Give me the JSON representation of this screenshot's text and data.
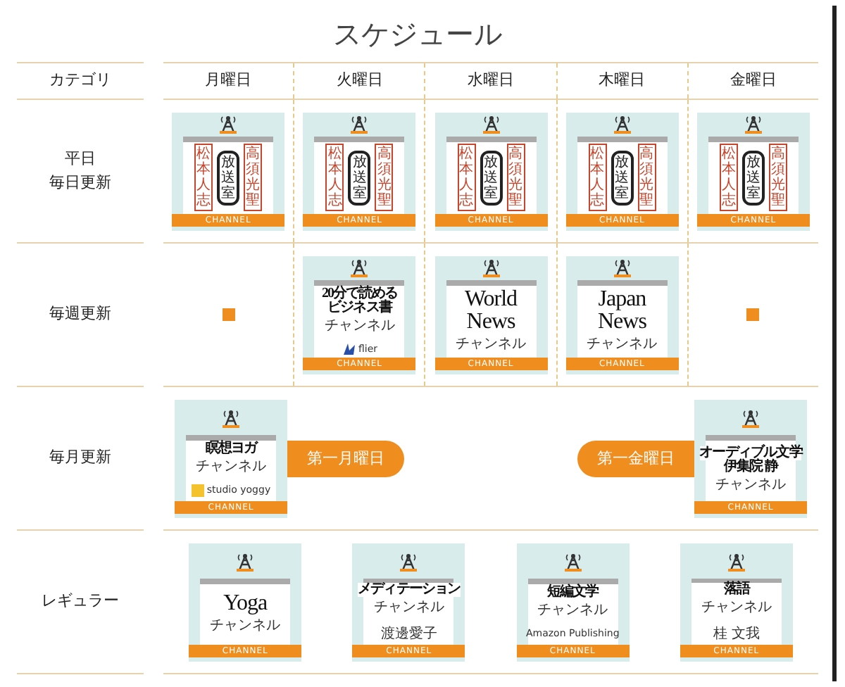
{
  "title": "スケジュール",
  "header": {
    "category": "カテゴリ",
    "days": [
      "月曜日",
      "火曜日",
      "水曜日",
      "木曜日",
      "金曜日"
    ]
  },
  "rows": [
    {
      "kind": "days",
      "category": [
        "平日",
        "毎日更新"
      ],
      "cells": [
        {
          "kind": "seal_cover",
          "seals": [
            {
              "text": "松本人志",
              "color": "#c8442a"
            },
            {
              "text": "放送室",
              "color": "#222222"
            },
            {
              "text": "高須光聖",
              "color": "#c8442a"
            }
          ],
          "band": "CHANNEL"
        },
        {
          "kind": "seal_cover",
          "seals": [
            {
              "text": "松本人志",
              "color": "#c8442a"
            },
            {
              "text": "放送室",
              "color": "#222222"
            },
            {
              "text": "高須光聖",
              "color": "#c8442a"
            }
          ],
          "band": "CHANNEL"
        },
        {
          "kind": "seal_cover",
          "seals": [
            {
              "text": "松本人志",
              "color": "#c8442a"
            },
            {
              "text": "放送室",
              "color": "#222222"
            },
            {
              "text": "高須光聖",
              "color": "#c8442a"
            }
          ],
          "band": "CHANNEL"
        },
        {
          "kind": "seal_cover",
          "seals": [
            {
              "text": "松本人志",
              "color": "#c8442a"
            },
            {
              "text": "放送室",
              "color": "#222222"
            },
            {
              "text": "高須光聖",
              "color": "#c8442a"
            }
          ],
          "band": "CHANNEL"
        },
        {
          "kind": "seal_cover",
          "seals": [
            {
              "text": "松本人志",
              "color": "#c8442a"
            },
            {
              "text": "放送室",
              "color": "#222222"
            },
            {
              "text": "高須光聖",
              "color": "#c8442a"
            }
          ],
          "band": "CHANNEL"
        }
      ]
    },
    {
      "kind": "days",
      "category": [
        "毎週更新"
      ],
      "cells": [
        {
          "kind": "none"
        },
        {
          "kind": "title_cover",
          "title": [
            "20分で読める",
            "ビジネス書"
          ],
          "subtitle": "チャンネル",
          "credit": {
            "text": "flier",
            "kind": "wave"
          },
          "band": "CHANNEL"
        },
        {
          "kind": "title_cover",
          "title": [
            "World",
            "News"
          ],
          "subtitle": "チャンネル",
          "band": "CHANNEL"
        },
        {
          "kind": "title_cover",
          "title": [
            "Japan",
            "News"
          ],
          "subtitle": "チャンネル",
          "band": "CHANNEL"
        },
        {
          "kind": "none"
        }
      ]
    },
    {
      "kind": "groups",
      "category": [
        "毎月更新"
      ],
      "groups": [
        [
          {
            "kind": "title_cover",
            "title": [
              "瞑想ヨガ"
            ],
            "subtitle": "チャンネル",
            "credit": {
              "text": "studio yoggy",
              "kind": "square"
            },
            "band": "CHANNEL"
          },
          {
            "kind": "tag",
            "text": "第一月曜日"
          }
        ],
        [
          {
            "kind": "tag",
            "text": "第一金曜日"
          },
          {
            "kind": "title_cover",
            "title": [
              "オーディブル文学",
              "伊集院 静"
            ],
            "subtitle": "チャンネル",
            "band": "CHANNEL"
          }
        ]
      ]
    },
    {
      "kind": "spread",
      "category": [
        "レギュラー"
      ],
      "cells": [
        {
          "kind": "title_cover",
          "title": [
            "Yoga"
          ],
          "subtitle": "チャンネル",
          "band": "CHANNEL"
        },
        {
          "kind": "title_cover",
          "title": [
            "メディテーション"
          ],
          "subtitle": "チャンネル",
          "credit": {
            "text": "渡邊愛子"
          },
          "band": "CHANNEL"
        },
        {
          "kind": "title_cover",
          "title": [
            "短編文学"
          ],
          "subtitle": "チャンネル",
          "credit": {
            "text": "Amazon Publishing"
          },
          "band": "CHANNEL"
        },
        {
          "kind": "title_cover",
          "title": [
            "落語"
          ],
          "subtitle": "チャンネル",
          "credit": {
            "text": "桂 文我"
          },
          "band": "CHANNEL"
        }
      ]
    }
  ]
}
